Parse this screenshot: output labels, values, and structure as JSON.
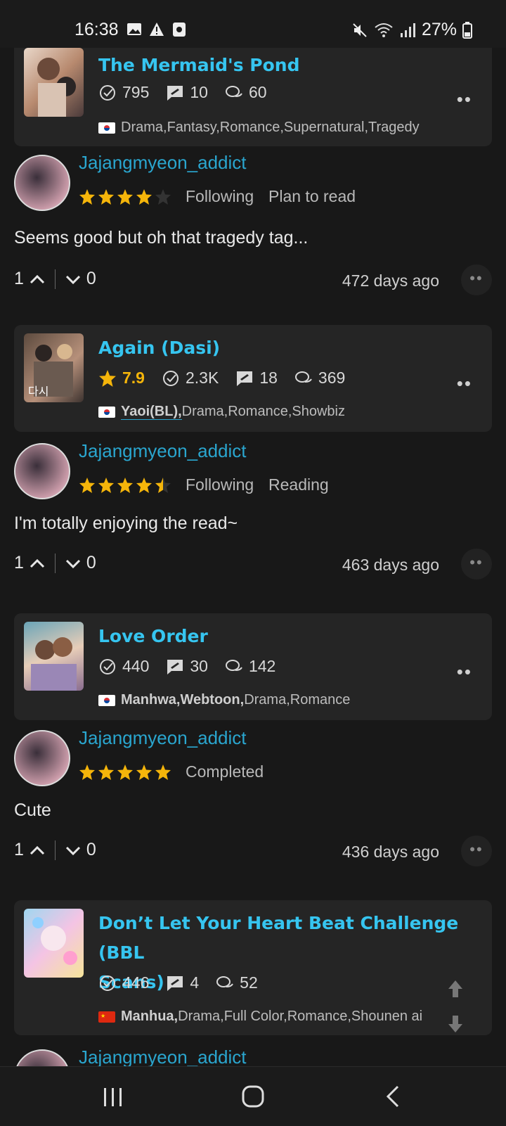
{
  "status_bar": {
    "time": "16:38",
    "battery": "27%"
  },
  "colors": {
    "accent_title": "#36c5f0",
    "username": "#2aa6cf",
    "star": "#f5b50a",
    "rating_text": "#f5b50a",
    "background": "#181818",
    "card": "#252525"
  },
  "entries": [
    {
      "card": {
        "title": "The Mermaid's Pond",
        "rating": "",
        "reads": "795",
        "reviews": "10",
        "comments": "60",
        "flag": "south-korea-flag",
        "tags_bold": "",
        "tags": "Drama,Fantasy,Romance,Supernatural,Tragedy"
      },
      "user": {
        "name": "Jajangmyeon_addict",
        "stars": 4,
        "status1": "Following",
        "status2": "Plan to read"
      },
      "comment": "Seems good but oh that tragedy tag...",
      "upvotes": "1",
      "downvotes": "0",
      "age": "472 days ago"
    },
    {
      "card": {
        "title": "Again (Dasi)",
        "rating": "7.9",
        "reads": "2.3K",
        "reviews": "18",
        "comments": "369",
        "flag": "south-korea-flag",
        "tags_bold": "Yaoi(BL),",
        "tags": "Drama,Romance,Showbiz"
      },
      "user": {
        "name": "Jajangmyeon_addict",
        "stars": 4.5,
        "status1": "Following",
        "status2": "Reading"
      },
      "comment": "I'm totally enjoying the read~",
      "upvotes": "1",
      "downvotes": "0",
      "age": "463 days ago"
    },
    {
      "card": {
        "title": "Love Order",
        "rating": "",
        "reads": "440",
        "reviews": "30",
        "comments": "142",
        "flag": "south-korea-flag",
        "tags_bold": "Manhwa,Webtoon,",
        "tags": "Drama,Romance"
      },
      "user": {
        "name": "Jajangmyeon_addict",
        "stars": 5,
        "status1": "Completed",
        "status2": ""
      },
      "comment": "Cute",
      "upvotes": "1",
      "downvotes": "0",
      "age": "436 days ago"
    },
    {
      "card": {
        "title_line1": "Don’t Let Your Heart Beat Challenge (BBL",
        "title_line2": "Scans)",
        "reads": "446",
        "reviews": "4",
        "comments": "52",
        "flag": "china-flag",
        "tags_bold": "Manhua,",
        "tags": "Drama,Full Color,Romance,Shounen ai"
      },
      "user": {
        "name": "Jajangmyeon_addict"
      }
    }
  ],
  "icons": {
    "read": "check-plus-icon",
    "review": "review-icon",
    "comment": "comments-icon",
    "upvote": "chevron-up-icon",
    "downvote": "chevron-down-icon"
  }
}
